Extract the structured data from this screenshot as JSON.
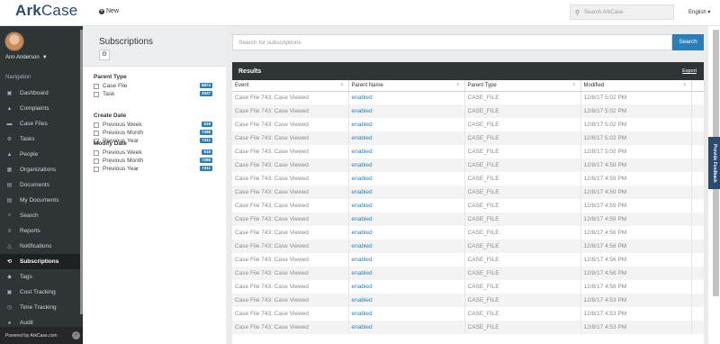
{
  "app": {
    "logo_main": "Ark",
    "logo_sub": "Case",
    "new_label": "New",
    "search_placeholder": "Search ArkCase",
    "language": "English ▾"
  },
  "user": {
    "name": "Ann Anderson"
  },
  "sidebar": {
    "nav_title": "Navigation",
    "items": [
      {
        "label": "Dashboard",
        "icon": "▣"
      },
      {
        "label": "Complaints",
        "icon": "▲"
      },
      {
        "label": "Case Files",
        "icon": "▬"
      },
      {
        "label": "Tasks",
        "icon": "⚙"
      },
      {
        "label": "People",
        "icon": "▲"
      },
      {
        "label": "Organizations",
        "icon": "▦"
      },
      {
        "label": "Documents",
        "icon": "▤"
      },
      {
        "label": "My Documents",
        "icon": "▤"
      },
      {
        "label": "Search",
        "icon": "⌕"
      },
      {
        "label": "Reports",
        "icon": "≡"
      },
      {
        "label": "Notifications",
        "icon": "△"
      },
      {
        "label": "Subscriptions",
        "icon": "⟲"
      },
      {
        "label": "Tags",
        "icon": "◆"
      },
      {
        "label": "Cost Tracking",
        "icon": "▣"
      },
      {
        "label": "Time Tracking",
        "icon": "◷"
      },
      {
        "label": "Audit",
        "icon": "●"
      }
    ],
    "active_index": 11,
    "powered_by": "Powered by ArkCase.com"
  },
  "facets": {
    "title": "Subscriptions",
    "groups": [
      {
        "title": "Parent Type",
        "rows": [
          {
            "label": "Case File",
            "count": "6874"
          },
          {
            "label": "Task",
            "count": "2537"
          }
        ]
      },
      {
        "title": "Create Date",
        "rows": [
          {
            "label": "Previous Week",
            "count": "519"
          },
          {
            "label": "Previous Month",
            "count": "7396"
          },
          {
            "label": "Previous Year",
            "count": "7411"
          }
        ]
      },
      {
        "title": "Modify Date",
        "rows": [
          {
            "label": "Previous Week",
            "count": "519"
          },
          {
            "label": "Previous Month",
            "count": "7396"
          },
          {
            "label": "Previous Year",
            "count": "7411"
          }
        ]
      }
    ]
  },
  "main": {
    "search_placeholder": "Search for subscriptions",
    "search_button": "Search",
    "results_title": "Results",
    "export_label": "Export",
    "columns": [
      "Event",
      "Parent Name",
      "Parent Type",
      "Modified"
    ],
    "rows": [
      [
        "Case File 743: Case Viewed",
        "enabled",
        "CASE_FILE",
        "12/8/17 5:02 PM"
      ],
      [
        "Case File 743: Case Viewed",
        "enabled",
        "CASE_FILE",
        "12/8/17 5:02 PM"
      ],
      [
        "Case File 743: Case Viewed",
        "enabled",
        "CASE_FILE",
        "12/8/17 5:02 PM"
      ],
      [
        "Case File 743: Case Viewed",
        "enabled",
        "CASE_FILE",
        "12/8/17 5:02 PM"
      ],
      [
        "Case File 743: Case Viewed",
        "enabled",
        "CASE_FILE",
        "12/8/17 5:02 PM"
      ],
      [
        "Case File 743: Case Viewed",
        "enabled",
        "CASE_FILE",
        "12/8/17 4:59 PM"
      ],
      [
        "Case File 743: Case Viewed",
        "enabled",
        "CASE_FILE",
        "12/8/17 4:59 PM"
      ],
      [
        "Case File 743: Case Viewed",
        "enabled",
        "CASE_FILE",
        "12/8/17 4:59 PM"
      ],
      [
        "Case File 743: Case Viewed",
        "enabled",
        "CASE_FILE",
        "12/8/17 4:59 PM"
      ],
      [
        "Case File 743: Case Viewed",
        "enabled",
        "CASE_FILE",
        "12/8/17 4:59 PM"
      ],
      [
        "Case File 743: Case Viewed",
        "enabled",
        "CASE_FILE",
        "12/8/17 4:56 PM"
      ],
      [
        "Case File 743: Case Viewed",
        "enabled",
        "CASE_FILE",
        "12/8/17 4:56 PM"
      ],
      [
        "Case File 743: Case Viewed",
        "enabled",
        "CASE_FILE",
        "12/8/17 4:56 PM"
      ],
      [
        "Case File 743: Case Viewed",
        "enabled",
        "CASE_FILE",
        "12/8/17 4:56 PM"
      ],
      [
        "Case File 743: Case Viewed",
        "enabled",
        "CASE_FILE",
        "12/8/17 4:56 PM"
      ],
      [
        "Case File 743: Case Viewed",
        "enabled",
        "CASE_FILE",
        "12/8/17 4:53 PM"
      ],
      [
        "Case File 743: Case Viewed",
        "enabled",
        "CASE_FILE",
        "12/8/17 4:53 PM"
      ],
      [
        "Case File 743: Case Viewed",
        "enabled",
        "CASE_FILE",
        "12/8/17 4:53 PM"
      ]
    ]
  },
  "feedback_label": "Provide Feedback",
  "colors": {
    "sidebar": "#2f3437",
    "accent": "#2a7fb8",
    "brand": "#2b4a6f"
  }
}
